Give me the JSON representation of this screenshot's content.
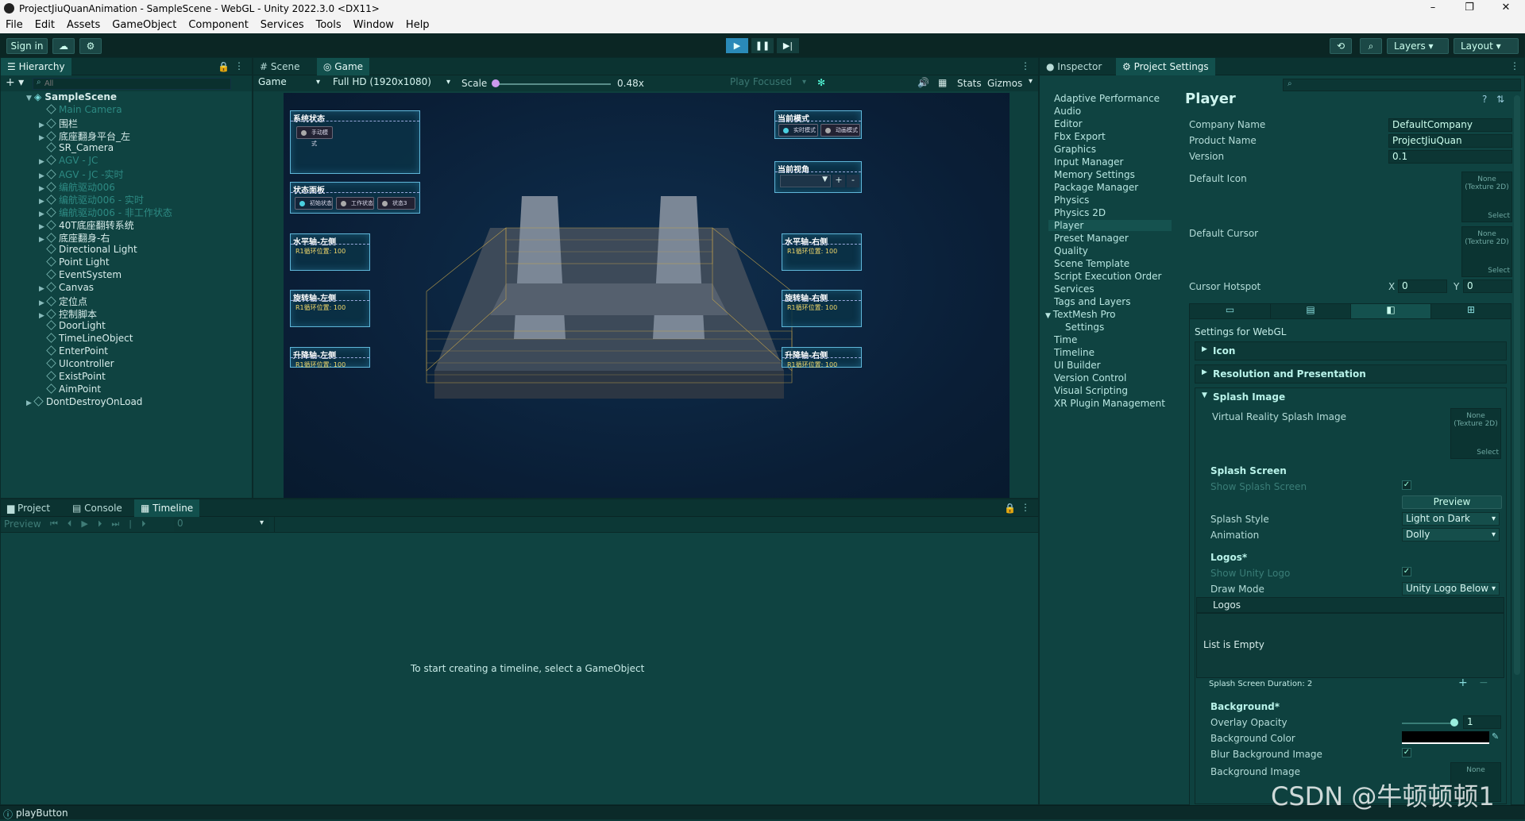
{
  "window": {
    "title": "ProjectJiuQuanAnimation - SampleScene - WebGL - Unity 2022.3.0 <DX11>",
    "minimize": "–",
    "maximize": "❐",
    "close": "✕"
  },
  "menu": [
    "File",
    "Edit",
    "Assets",
    "GameObject",
    "Component",
    "Services",
    "Tools",
    "Window",
    "Help"
  ],
  "toolbar": {
    "signin": "Sign in",
    "layers": "Layers",
    "layout": "Layout"
  },
  "hierarchy": {
    "tab": "Hierarchy",
    "search_placeholder": "All",
    "scene": "SampleScene",
    "items": [
      {
        "label": "Main Camera",
        "dim": true,
        "depth": 1,
        "arrow": false
      },
      {
        "label": "围栏",
        "dim": false,
        "depth": 1,
        "arrow": true
      },
      {
        "label": "底座翻身平台_左",
        "dim": false,
        "depth": 1,
        "arrow": true
      },
      {
        "label": "SR_Camera",
        "dim": false,
        "depth": 1,
        "arrow": false
      },
      {
        "label": "AGV - JC",
        "dim": true,
        "depth": 1,
        "arrow": true
      },
      {
        "label": "AGV - JC -实时",
        "dim": true,
        "depth": 1,
        "arrow": true
      },
      {
        "label": "编航驱动006",
        "dim": true,
        "depth": 1,
        "arrow": true
      },
      {
        "label": "编航驱动006 - 实时",
        "dim": true,
        "depth": 1,
        "arrow": true
      },
      {
        "label": "编航驱动006 - 非工作状态",
        "dim": true,
        "depth": 1,
        "arrow": true
      },
      {
        "label": "40T底座翻转系统",
        "dim": false,
        "depth": 1,
        "arrow": true
      },
      {
        "label": "底座翻身-右",
        "dim": false,
        "depth": 1,
        "arrow": true
      },
      {
        "label": "Directional Light",
        "dim": false,
        "depth": 1,
        "arrow": false
      },
      {
        "label": "Point Light",
        "dim": false,
        "depth": 1,
        "arrow": false
      },
      {
        "label": "EventSystem",
        "dim": false,
        "depth": 1,
        "arrow": false
      },
      {
        "label": "Canvas",
        "dim": false,
        "depth": 1,
        "arrow": true
      },
      {
        "label": "定位点",
        "dim": false,
        "depth": 1,
        "arrow": true
      },
      {
        "label": "控制脚本",
        "dim": false,
        "depth": 1,
        "arrow": true
      },
      {
        "label": "DoorLight",
        "dim": false,
        "depth": 1,
        "arrow": false
      },
      {
        "label": "TimeLineObject",
        "dim": false,
        "depth": 1,
        "arrow": false
      },
      {
        "label": "EnterPoint",
        "dim": false,
        "depth": 1,
        "arrow": false
      },
      {
        "label": "UIcontroller",
        "dim": false,
        "depth": 1,
        "arrow": false
      },
      {
        "label": "ExistPoint",
        "dim": false,
        "depth": 1,
        "arrow": false
      },
      {
        "label": "AimPoint",
        "dim": false,
        "depth": 1,
        "arrow": false
      },
      {
        "label": "DontDestroyOnLoad",
        "dim": false,
        "depth": 0,
        "arrow": true
      }
    ]
  },
  "scene_tabs": {
    "scene": "Scene",
    "game": "Game"
  },
  "game_bar": {
    "display": "Game",
    "resolution": "Full HD (1920x1080)",
    "scale_label": "Scale",
    "scale_value": "0.48x",
    "play_focused": "Play Focused",
    "stats": "Stats",
    "gizmos": "Gizmos"
  },
  "hud": {
    "system_state": "系统状态",
    "manual_mode": "手动模式",
    "status_panel": "状态面板",
    "status_buttons": [
      "初始状态",
      "工作状态",
      "状态3"
    ],
    "current_mode": "当前模式",
    "mode_buttons": [
      "实时模式",
      "动画模式"
    ],
    "current_view": "当前视角",
    "plus": "+",
    "minus": "-",
    "h_left": "水平轴-左侧",
    "h_right": "水平轴-右侧",
    "r_left": "旋转轴-左侧",
    "r_right": "旋转轴-右侧",
    "l_left": "升降轴-左侧",
    "l_right": "升降轴-右侧",
    "value_line": "R1循环位置: 100"
  },
  "bottom": {
    "tabs": [
      "Project",
      "Console",
      "Timeline"
    ],
    "preview": "Preview",
    "frame": "0",
    "message": "To start creating a timeline, select a GameObject"
  },
  "inspector_tabs": {
    "inspector": "Inspector",
    "project_settings": "Project Settings"
  },
  "settings_list": [
    "Adaptive Performance",
    "Audio",
    "Editor",
    "Fbx Export",
    "Graphics",
    "Input Manager",
    "Memory Settings",
    "Package Manager",
    "Physics",
    "Physics 2D",
    "Player",
    "Preset Manager",
    "Quality",
    "Scene Template",
    "Script Execution Order",
    "Services",
    "Tags and Layers",
    "TextMesh Pro",
    "Settings",
    "Time",
    "Timeline",
    "UI Builder",
    "Version Control",
    "Visual Scripting",
    "XR Plugin Management"
  ],
  "player": {
    "title": "Player",
    "company_label": "Company Name",
    "company": "DefaultCompany",
    "product_label": "Product Name",
    "product": "ProjectJiuQuan",
    "version_label": "Version",
    "version": "0.1",
    "default_icon": "Default Icon",
    "default_cursor": "Default Cursor",
    "tex_none": "None",
    "tex_type": "(Texture 2D)",
    "tex_select": "Select",
    "hotspot_label": "Cursor Hotspot",
    "hx_label": "X",
    "hx": "0",
    "hy_label": "Y",
    "hy": "0",
    "settings_for": "Settings for WebGL",
    "fold_icon": "Icon",
    "fold_resolution": "Resolution and Presentation",
    "fold_splash": "Splash Image",
    "vr_splash": "Virtual Reality Splash Image",
    "splash_screen": "Splash Screen",
    "show_splash": "Show Splash Screen",
    "preview": "Preview",
    "splash_style_label": "Splash Style",
    "splash_style": "Light on Dark",
    "animation_label": "Animation",
    "animation": "Dolly",
    "logos_header": "Logos*",
    "show_unity_logo": "Show Unity Logo",
    "draw_mode_label": "Draw Mode",
    "draw_mode": "Unity Logo Below",
    "logos_list": "Logos",
    "list_empty": "List is Empty",
    "duration": "Splash Screen Duration: 2",
    "background_header": "Background*",
    "overlay_label": "Overlay Opacity",
    "overlay": "1",
    "bg_color_label": "Background Color",
    "blur_label": "Blur Background Image",
    "bg_image_label": "Background Image"
  },
  "status": {
    "text": "playButton"
  },
  "watermark": "CSDN @牛顿顿顿1"
}
